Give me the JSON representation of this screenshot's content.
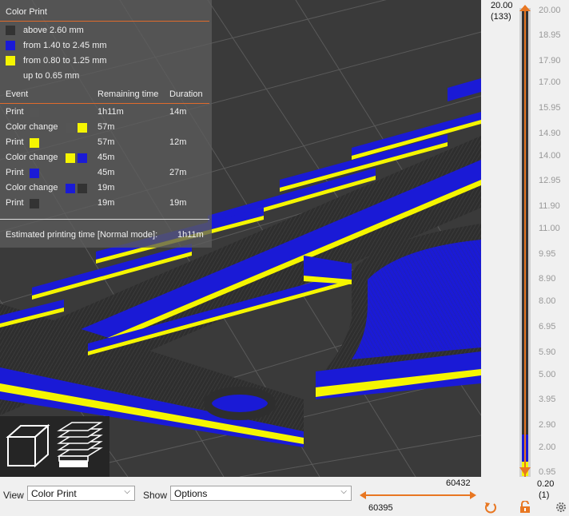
{
  "legend": {
    "title": "Color Print",
    "items": [
      {
        "label": "above 2.60 mm",
        "color": "#333333"
      },
      {
        "label": "from 1.40 to 2.45 mm",
        "color": "#1a1ad6"
      },
      {
        "label": "from 0.80 to 1.25 mm",
        "color": "#f5f500"
      },
      {
        "label": "up to 0.65 mm",
        "color": ""
      }
    ],
    "headers": {
      "event": "Event",
      "remaining": "Remaining time",
      "duration": "Duration"
    },
    "events": [
      {
        "event": "Print",
        "remaining": "1h11m",
        "duration": "14m",
        "colors": [
          "#555555"
        ]
      },
      {
        "event": "Color change",
        "remaining": "57m",
        "duration": "",
        "colors": [
          "#555555",
          "#f5f500"
        ]
      },
      {
        "event": "Print",
        "remaining": "57m",
        "duration": "12m",
        "colors": [
          "#f5f500"
        ]
      },
      {
        "event": "Color change",
        "remaining": "45m",
        "duration": "",
        "colors": [
          "#f5f500",
          "#1a1ad6"
        ]
      },
      {
        "event": "Print",
        "remaining": "45m",
        "duration": "27m",
        "colors": [
          "#1a1ad6"
        ]
      },
      {
        "event": "Color change",
        "remaining": "19m",
        "duration": "",
        "colors": [
          "#1a1ad6",
          "#333333"
        ]
      },
      {
        "event": "Print",
        "remaining": "19m",
        "duration": "19m",
        "colors": [
          "#333333"
        ]
      }
    ],
    "estimate_label": "Estimated printing time [Normal mode]:",
    "estimate_value": "1h11m"
  },
  "view_buttons": [
    {
      "name": "iso-view-icon"
    },
    {
      "name": "layers-view-icon"
    }
  ],
  "vslider": {
    "top_value": "20.00",
    "top_layer": "(133)",
    "bottom_value": "0.20",
    "bottom_layer": "(1)",
    "ticks": [
      "20.00",
      "18.95",
      "17.90",
      "17.00",
      "15.95",
      "14.90",
      "14.00",
      "12.95",
      "11.90",
      "11.00",
      "9.95",
      "8.90",
      "8.00",
      "6.95",
      "5.90",
      "5.00",
      "3.95",
      "2.90",
      "2.00",
      "0.95"
    ]
  },
  "bottom_bar": {
    "view_label": "View",
    "view_value": "Color Print",
    "show_label": "Show",
    "show_value": "Options",
    "hslider_upper": "60432",
    "hslider_lower": "60395"
  },
  "colors": {
    "accent": "#e87722",
    "yellow": "#f5f500",
    "blue": "#1a1ad6",
    "dark": "#333333"
  }
}
